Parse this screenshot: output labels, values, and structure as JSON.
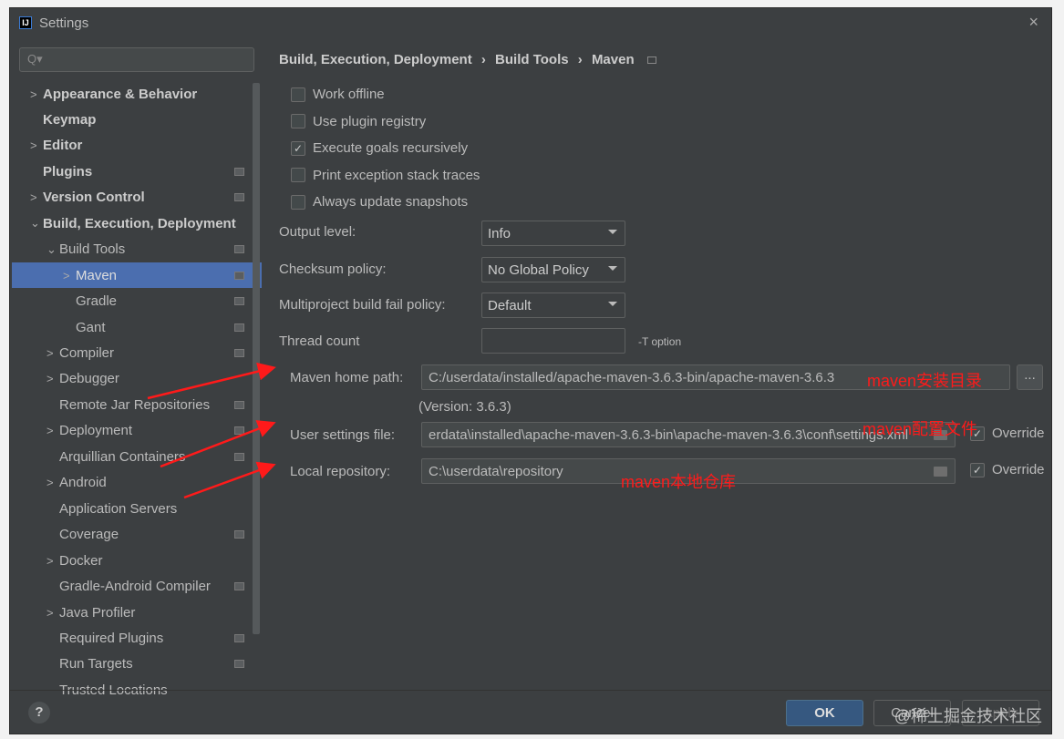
{
  "window": {
    "title": "Settings",
    "close": "×"
  },
  "search": {
    "placeholder": "Q▾"
  },
  "sidebar": {
    "items": [
      {
        "label": "Appearance & Behavior",
        "chev": ">",
        "bold": true,
        "indent": 0,
        "page": false
      },
      {
        "label": "Keymap",
        "chev": "",
        "bold": true,
        "indent": 0,
        "page": false
      },
      {
        "label": "Editor",
        "chev": ">",
        "bold": true,
        "indent": 0,
        "page": false
      },
      {
        "label": "Plugins",
        "chev": "",
        "bold": true,
        "indent": 0,
        "page": true
      },
      {
        "label": "Version Control",
        "chev": ">",
        "bold": true,
        "indent": 0,
        "page": true
      },
      {
        "label": "Build, Execution, Deployment",
        "chev": "⌄",
        "bold": true,
        "indent": 0,
        "page": false
      },
      {
        "label": "Build Tools",
        "chev": "⌄",
        "bold": false,
        "indent": 1,
        "page": true
      },
      {
        "label": "Maven",
        "chev": ">",
        "bold": false,
        "indent": 2,
        "page": true,
        "selected": true
      },
      {
        "label": "Gradle",
        "chev": "",
        "bold": false,
        "indent": 2,
        "page": true
      },
      {
        "label": "Gant",
        "chev": "",
        "bold": false,
        "indent": 2,
        "page": true
      },
      {
        "label": "Compiler",
        "chev": ">",
        "bold": false,
        "indent": 1,
        "page": true
      },
      {
        "label": "Debugger",
        "chev": ">",
        "bold": false,
        "indent": 1,
        "page": false
      },
      {
        "label": "Remote Jar Repositories",
        "chev": "",
        "bold": false,
        "indent": 1,
        "page": true
      },
      {
        "label": "Deployment",
        "chev": ">",
        "bold": false,
        "indent": 1,
        "page": true
      },
      {
        "label": "Arquillian Containers",
        "chev": "",
        "bold": false,
        "indent": 1,
        "page": true
      },
      {
        "label": "Android",
        "chev": ">",
        "bold": false,
        "indent": 1,
        "page": false
      },
      {
        "label": "Application Servers",
        "chev": "",
        "bold": false,
        "indent": 1,
        "page": false
      },
      {
        "label": "Coverage",
        "chev": "",
        "bold": false,
        "indent": 1,
        "page": true
      },
      {
        "label": "Docker",
        "chev": ">",
        "bold": false,
        "indent": 1,
        "page": false
      },
      {
        "label": "Gradle-Android Compiler",
        "chev": "",
        "bold": false,
        "indent": 1,
        "page": true
      },
      {
        "label": "Java Profiler",
        "chev": ">",
        "bold": false,
        "indent": 1,
        "page": false
      },
      {
        "label": "Required Plugins",
        "chev": "",
        "bold": false,
        "indent": 1,
        "page": true
      },
      {
        "label": "Run Targets",
        "chev": "",
        "bold": false,
        "indent": 1,
        "page": true
      },
      {
        "label": "Trusted Locations",
        "chev": "",
        "bold": false,
        "indent": 1,
        "page": false
      }
    ]
  },
  "breadcrumb": [
    "Build, Execution, Deployment",
    "Build Tools",
    "Maven"
  ],
  "breadcrumb_sep": "›",
  "checkboxes": [
    {
      "label": "Work offline",
      "checked": false
    },
    {
      "label": "Use plugin registry",
      "checked": false
    },
    {
      "label": "Execute goals recursively",
      "checked": true
    },
    {
      "label": "Print exception stack traces",
      "checked": false
    },
    {
      "label": "Always update snapshots",
      "checked": false
    }
  ],
  "output_level": {
    "label": "Output level:",
    "value": "Info"
  },
  "checksum": {
    "label": "Checksum policy:",
    "value": "No Global Policy"
  },
  "fail_policy": {
    "label": "Multiproject build fail policy:",
    "value": "Default"
  },
  "thread_count": {
    "label": "Thread count",
    "value": "",
    "hint": "-T option"
  },
  "maven_home": {
    "label": "Maven home path:",
    "value": "C:/userdata/installed/apache-maven-3.6.3-bin/apache-maven-3.6.3",
    "browse": "...",
    "version": "(Version: 3.6.3)"
  },
  "user_settings": {
    "label": "User settings file:",
    "value": "erdata\\installed\\apache-maven-3.6.3-bin\\apache-maven-3.6.3\\conf\\settings.xml",
    "override": "Override",
    "checked": true
  },
  "local_repo": {
    "label": "Local repository:",
    "value": "C:\\userdata\\repository",
    "override": "Override",
    "checked": true
  },
  "annotations": {
    "home": "maven安装目录",
    "settings": "maven配置文件",
    "repo": "maven本地仓库"
  },
  "annotation_color": "#ff1a1a",
  "footer": {
    "help": "?",
    "ok": "OK",
    "cancel": "Cancel",
    "apply": "Apply",
    "watermark": "@稀土掘金技术社区"
  }
}
